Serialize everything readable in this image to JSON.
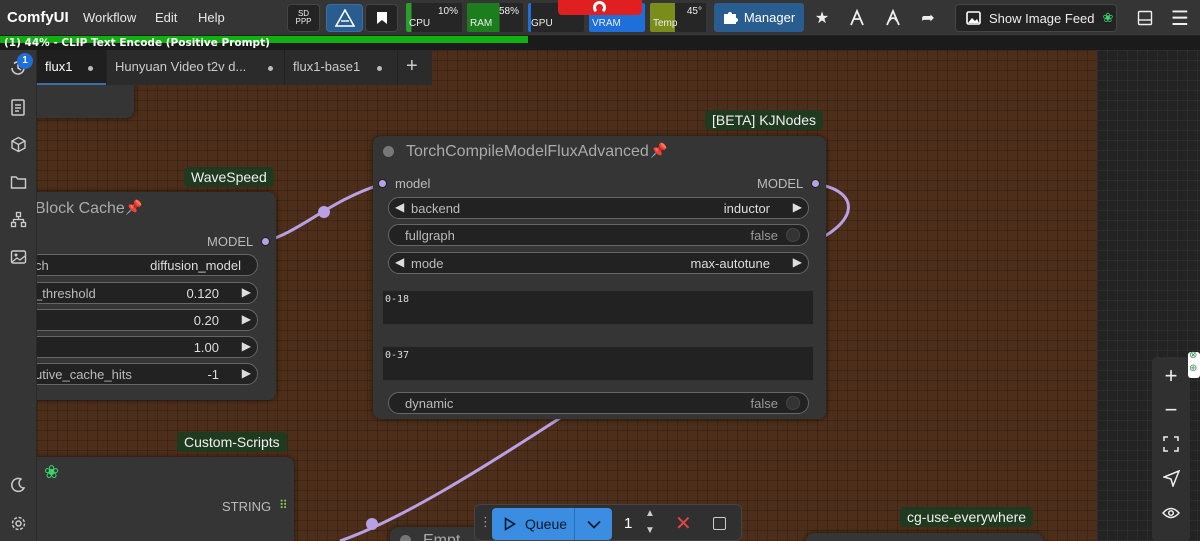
{
  "app": {
    "title": "ComfyUI"
  },
  "menu": {
    "items": [
      "Workflow",
      "Edit",
      "Help"
    ]
  },
  "toolbar": {
    "sd_label_1": "SD",
    "sd_label_2": "PPP",
    "meters": [
      {
        "label": "CPU",
        "value": "10%",
        "level": 0.1,
        "color": "#2a9d2a"
      },
      {
        "label": "RAM",
        "value": "58%",
        "level": 0.58,
        "color": "#1c7d1c"
      },
      {
        "label": "GPU",
        "value": "",
        "level": 0.05,
        "color": "#1e6fd9"
      },
      {
        "label": "VRAM",
        "value": "",
        "level": 1.0,
        "color": "#1e6fd9"
      },
      {
        "label": "Temp",
        "value": "45°",
        "level": 0.45,
        "color": "#7a8d1a"
      }
    ],
    "manager_label": "Manager",
    "image_feed_label": "Show Image Feed"
  },
  "progress": {
    "text": "(1) 44% - CLIP Text Encode (Positive Prompt)",
    "percent": 44,
    "color": "#10b010"
  },
  "sidebar": {
    "queue_badge": "1",
    "icons": [
      "history-icon",
      "document-icon",
      "cube-icon",
      "folder-icon",
      "node-library-icon",
      "image-gallery-icon"
    ],
    "bottom_icons": [
      "theme-moon-icon",
      "settings-gear-icon"
    ]
  },
  "tabs": [
    {
      "label": "flux1",
      "active": true
    },
    {
      "label": "Hunyuan Video t2v d...",
      "active": false
    },
    {
      "label": "flux1-base1",
      "active": false
    }
  ],
  "groups": {
    "kjnodes": "[BETA] KJNodes",
    "wavespeed": "WaveSpeed",
    "custom_scripts": "Custom-Scripts",
    "cg_use_everywhere": "cg-use-everywhere"
  },
  "node_torch": {
    "title": "TorchCompileModelFluxAdvanced",
    "input_label": "model",
    "output_label": "MODEL",
    "backend_label": "backend",
    "backend_value": "inductor",
    "fullgraph_label": "fullgraph",
    "fullgraph_value": "false",
    "mode_label": "mode",
    "mode_value": "max-autotune",
    "double_blocks": "0-18",
    "single_blocks": "0-37",
    "dynamic_label": "dynamic",
    "dynamic_value": "false"
  },
  "node_blockcache": {
    "title": "Block Cache",
    "output_label": "MODEL",
    "rows": [
      {
        "label": "ch",
        "value": "diffusion_model"
      },
      {
        "label": "_threshold",
        "value": "0.120"
      },
      {
        "label": "",
        "value": "0.20"
      },
      {
        "label": "",
        "value": "1.00"
      },
      {
        "label": "utive_cache_hits",
        "value": "-1"
      }
    ]
  },
  "node_custom": {
    "output_label": "STRING"
  },
  "node_bottom": {
    "title": "Empt"
  },
  "queue": {
    "label": "Queue",
    "count": "1"
  }
}
